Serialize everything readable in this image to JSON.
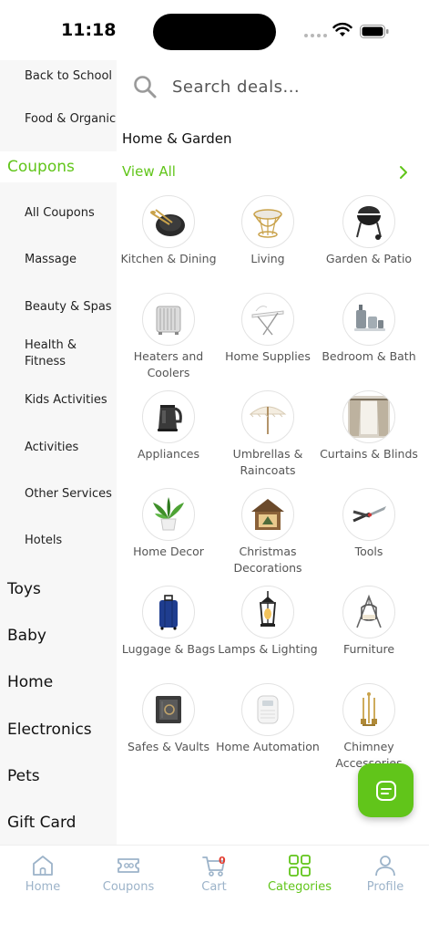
{
  "status": {
    "time": "11:18"
  },
  "sidebar": {
    "items": [
      {
        "label": "Back to School",
        "type": "sub"
      },
      {
        "label": "Food & Organic",
        "type": "sub"
      },
      {
        "label": "Coupons",
        "type": "active"
      },
      {
        "label": "All Coupons",
        "type": "sub"
      },
      {
        "label": "Massage",
        "type": "sub"
      },
      {
        "label": "Beauty & Spas",
        "type": "sub"
      },
      {
        "label": "Health & Fitness",
        "type": "sub"
      },
      {
        "label": "Kids Activities",
        "type": "sub"
      },
      {
        "label": "Activities",
        "type": "sub"
      },
      {
        "label": "Other Services",
        "type": "sub"
      },
      {
        "label": "Hotels",
        "type": "sub"
      },
      {
        "label": "Toys",
        "type": "main"
      },
      {
        "label": "Baby",
        "type": "main"
      },
      {
        "label": "Home",
        "type": "main"
      },
      {
        "label": "Electronics",
        "type": "main"
      },
      {
        "label": "Pets",
        "type": "main"
      },
      {
        "label": "Gift Card",
        "type": "main"
      }
    ]
  },
  "search": {
    "placeholder": "Search deals..."
  },
  "section": {
    "title": "Home & Garden",
    "view_all": "View All"
  },
  "categories": [
    {
      "label": "Kitchen & Dining",
      "icon": "cookware-icon"
    },
    {
      "label": "Living",
      "icon": "side-table-icon"
    },
    {
      "label": "Garden & Patio",
      "icon": "grill-icon"
    },
    {
      "label": "Heaters and Coolers",
      "icon": "heater-icon"
    },
    {
      "label": "Home Supplies",
      "icon": "drying-rack-icon"
    },
    {
      "label": "Bedroom & Bath",
      "icon": "bath-set-icon"
    },
    {
      "label": "Appliances",
      "icon": "kettle-icon"
    },
    {
      "label": "Umbrellas & Raincoats",
      "icon": "umbrella-icon"
    },
    {
      "label": "Curtains & Blinds",
      "icon": "curtains-icon"
    },
    {
      "label": "Home Decor",
      "icon": "plant-icon"
    },
    {
      "label": "Christmas Decorations",
      "icon": "christmas-house-icon"
    },
    {
      "label": "Tools",
      "icon": "shears-icon"
    },
    {
      "label": "Luggage & Bags",
      "icon": "suitcase-icon"
    },
    {
      "label": "Lamps & Lighting",
      "icon": "lantern-icon"
    },
    {
      "label": "Furniture",
      "icon": "swing-chair-icon"
    },
    {
      "label": "Safes & Vaults",
      "icon": "safe-icon"
    },
    {
      "label": "Home Automation",
      "icon": "thermostat-icon"
    },
    {
      "label": "Chimney Accessories",
      "icon": "fireplace-tools-icon"
    }
  ],
  "tabbar": {
    "items": [
      {
        "label": "Home",
        "icon": "home-icon"
      },
      {
        "label": "Coupons",
        "icon": "ticket-icon"
      },
      {
        "label": "Cart",
        "icon": "cart-icon",
        "badge": "0"
      },
      {
        "label": "Categories",
        "icon": "grid-icon",
        "active": true
      },
      {
        "label": "Profile",
        "icon": "user-icon"
      }
    ]
  },
  "colors": {
    "accent": "#61c51a",
    "tab_inactive": "#9cb3c9",
    "badge": "#e23b2e"
  }
}
